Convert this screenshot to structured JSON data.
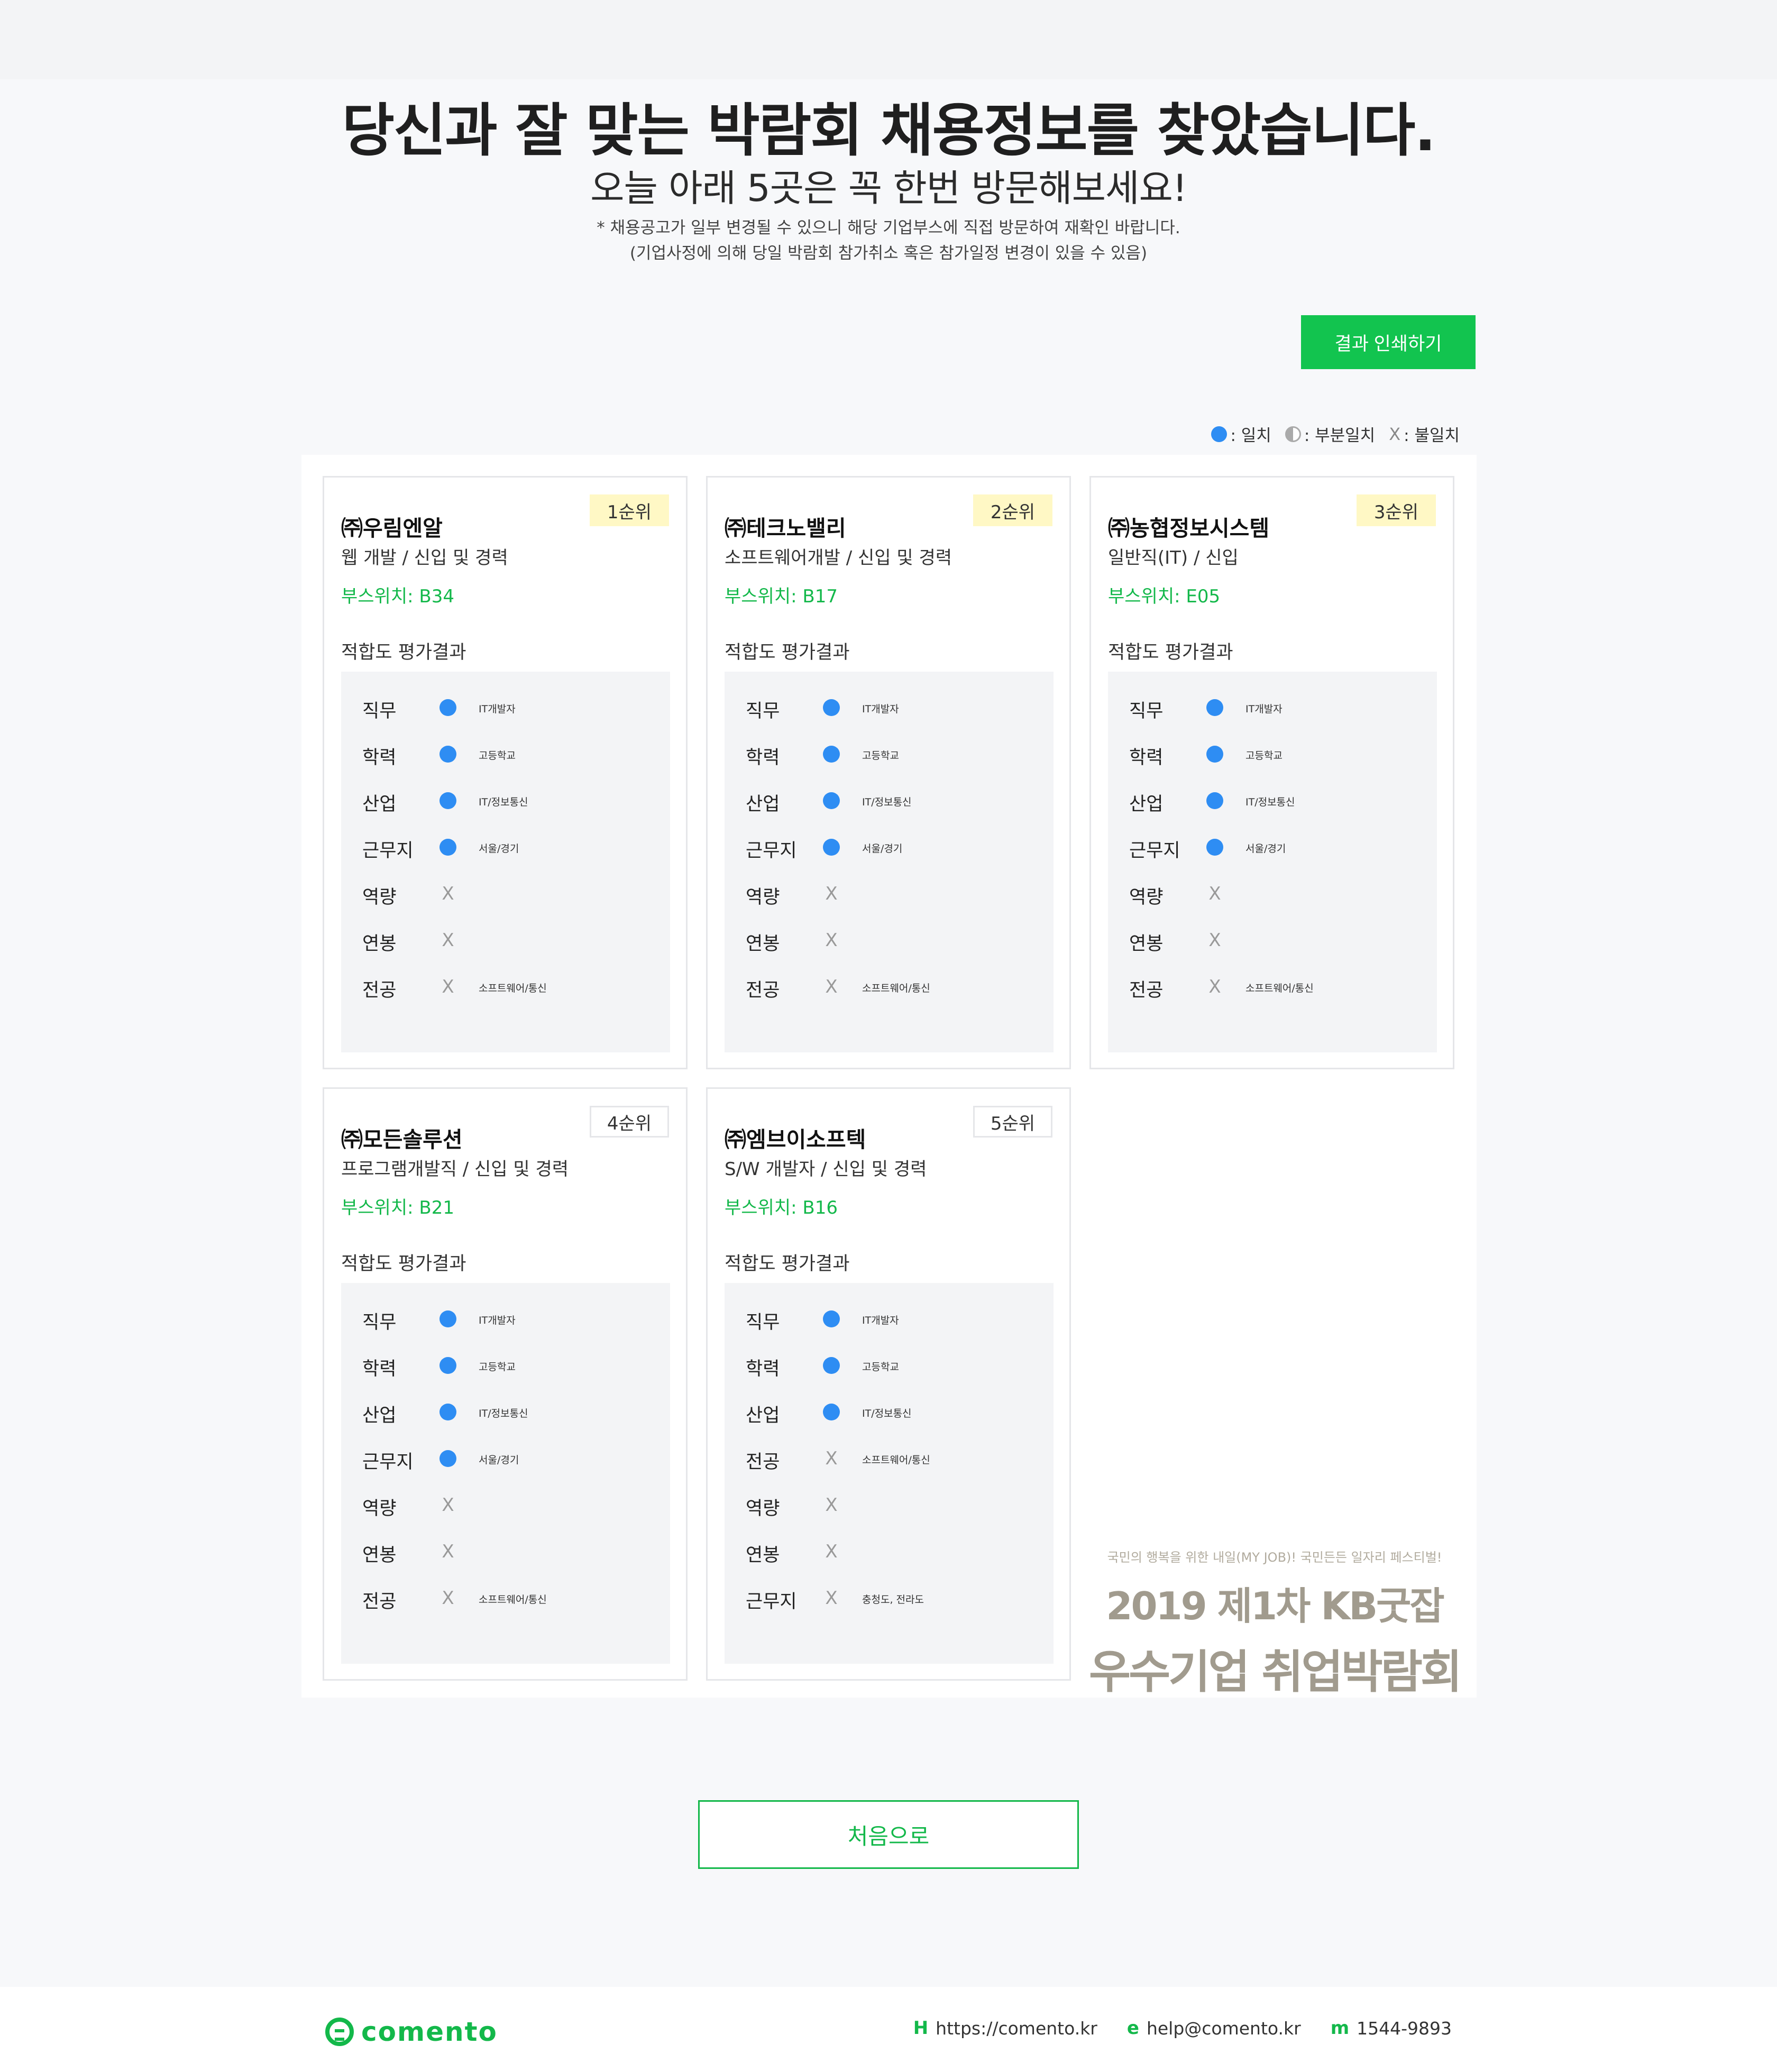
{
  "header": {
    "title": "당신과 잘 맞는 박람회 채용정보를 찾았습니다.",
    "subtitle": "오늘 아래 5곳은 꼭 한번 방문해보세요!",
    "note1": "* 채용공고가 일부 변경될 수 있으니 해당 기업부스에 직접 방문하여 재확인 바랍니다.",
    "note2": "(기업사정에 의해 당일 박람회 참가취소 혹은 참가일정 변경이 있을 수 있음)"
  },
  "print_button": "결과 인쇄하기",
  "legend": {
    "match": ": 일치",
    "partial": ": 부분일치",
    "mismatch_symbol": "X",
    "mismatch": ": 불일치"
  },
  "fit_title": "적합도 평가결과",
  "cards": [
    {
      "rank": "1순위",
      "company": "㈜우림엔알",
      "job": "웹 개발 / 신입 및 경력",
      "booth": "부스위치: B34",
      "rows": [
        {
          "label": "직무",
          "status": "match",
          "value": "IT개발자"
        },
        {
          "label": "학력",
          "status": "match",
          "value": "고등학교"
        },
        {
          "label": "산업",
          "status": "match",
          "value": "IT/정보통신"
        },
        {
          "label": "근무지",
          "status": "match",
          "value": "서울/경기"
        },
        {
          "label": "역량",
          "status": "mismatch",
          "value": ""
        },
        {
          "label": "연봉",
          "status": "mismatch",
          "value": ""
        },
        {
          "label": "전공",
          "status": "mismatch",
          "value": "소프트웨어/통신"
        }
      ]
    },
    {
      "rank": "2순위",
      "company": "㈜테크노밸리",
      "job": "소프트웨어개발 / 신입 및 경력",
      "booth": "부스위치: B17",
      "rows": [
        {
          "label": "직무",
          "status": "match",
          "value": "IT개발자"
        },
        {
          "label": "학력",
          "status": "match",
          "value": "고등학교"
        },
        {
          "label": "산업",
          "status": "match",
          "value": "IT/정보통신"
        },
        {
          "label": "근무지",
          "status": "match",
          "value": "서울/경기"
        },
        {
          "label": "역량",
          "status": "mismatch",
          "value": ""
        },
        {
          "label": "연봉",
          "status": "mismatch",
          "value": ""
        },
        {
          "label": "전공",
          "status": "mismatch",
          "value": "소프트웨어/통신"
        }
      ]
    },
    {
      "rank": "3순위",
      "company": "㈜농협정보시스템",
      "job": "일반직(IT) / 신입",
      "booth": "부스위치: E05",
      "rows": [
        {
          "label": "직무",
          "status": "match",
          "value": "IT개발자"
        },
        {
          "label": "학력",
          "status": "match",
          "value": "고등학교"
        },
        {
          "label": "산업",
          "status": "match",
          "value": "IT/정보통신"
        },
        {
          "label": "근무지",
          "status": "match",
          "value": "서울/경기"
        },
        {
          "label": "역량",
          "status": "mismatch",
          "value": ""
        },
        {
          "label": "연봉",
          "status": "mismatch",
          "value": ""
        },
        {
          "label": "전공",
          "status": "mismatch",
          "value": "소프트웨어/통신"
        }
      ]
    },
    {
      "rank": "4순위",
      "company": "㈜모든솔루션",
      "job": "프로그램개발직 / 신입 및 경력",
      "booth": "부스위치: B21",
      "rows": [
        {
          "label": "직무",
          "status": "match",
          "value": "IT개발자"
        },
        {
          "label": "학력",
          "status": "match",
          "value": "고등학교"
        },
        {
          "label": "산업",
          "status": "match",
          "value": "IT/정보통신"
        },
        {
          "label": "근무지",
          "status": "match",
          "value": "서울/경기"
        },
        {
          "label": "역량",
          "status": "mismatch",
          "value": ""
        },
        {
          "label": "연봉",
          "status": "mismatch",
          "value": ""
        },
        {
          "label": "전공",
          "status": "mismatch",
          "value": "소프트웨어/통신"
        }
      ]
    },
    {
      "rank": "5순위",
      "company": "㈜엠브이소프텍",
      "job": "S/W 개발자 / 신입 및 경력",
      "booth": "부스위치: B16",
      "rows": [
        {
          "label": "직무",
          "status": "match",
          "value": "IT개발자"
        },
        {
          "label": "학력",
          "status": "match",
          "value": "고등학교"
        },
        {
          "label": "산업",
          "status": "match",
          "value": "IT/정보통신"
        },
        {
          "label": "전공",
          "status": "mismatch",
          "value": "소프트웨어/통신"
        },
        {
          "label": "역량",
          "status": "mismatch",
          "value": ""
        },
        {
          "label": "연봉",
          "status": "mismatch",
          "value": ""
        },
        {
          "label": "근무지",
          "status": "mismatch",
          "value": "충청도, 전라도"
        }
      ]
    }
  ],
  "promo": {
    "tagline": "국민의 행복을 위한 내일(MY JOB)! 국민든든 일자리 페스티벌!",
    "line1": "2019 제1차 KB굿잡",
    "line2": "우수기업 취업박람회"
  },
  "home_button": "처음으로",
  "footer": {
    "logo_text": "comento",
    "homepage_icon": "H",
    "homepage": "https://comento.kr",
    "email_icon": "e",
    "email": "help@comento.kr",
    "phone_icon": "m",
    "phone": "1544-9893"
  },
  "colors": {
    "accent_green": "#13b84a",
    "match_blue": "#2e8df3",
    "rank_gold_bg": "#fff8c5"
  }
}
